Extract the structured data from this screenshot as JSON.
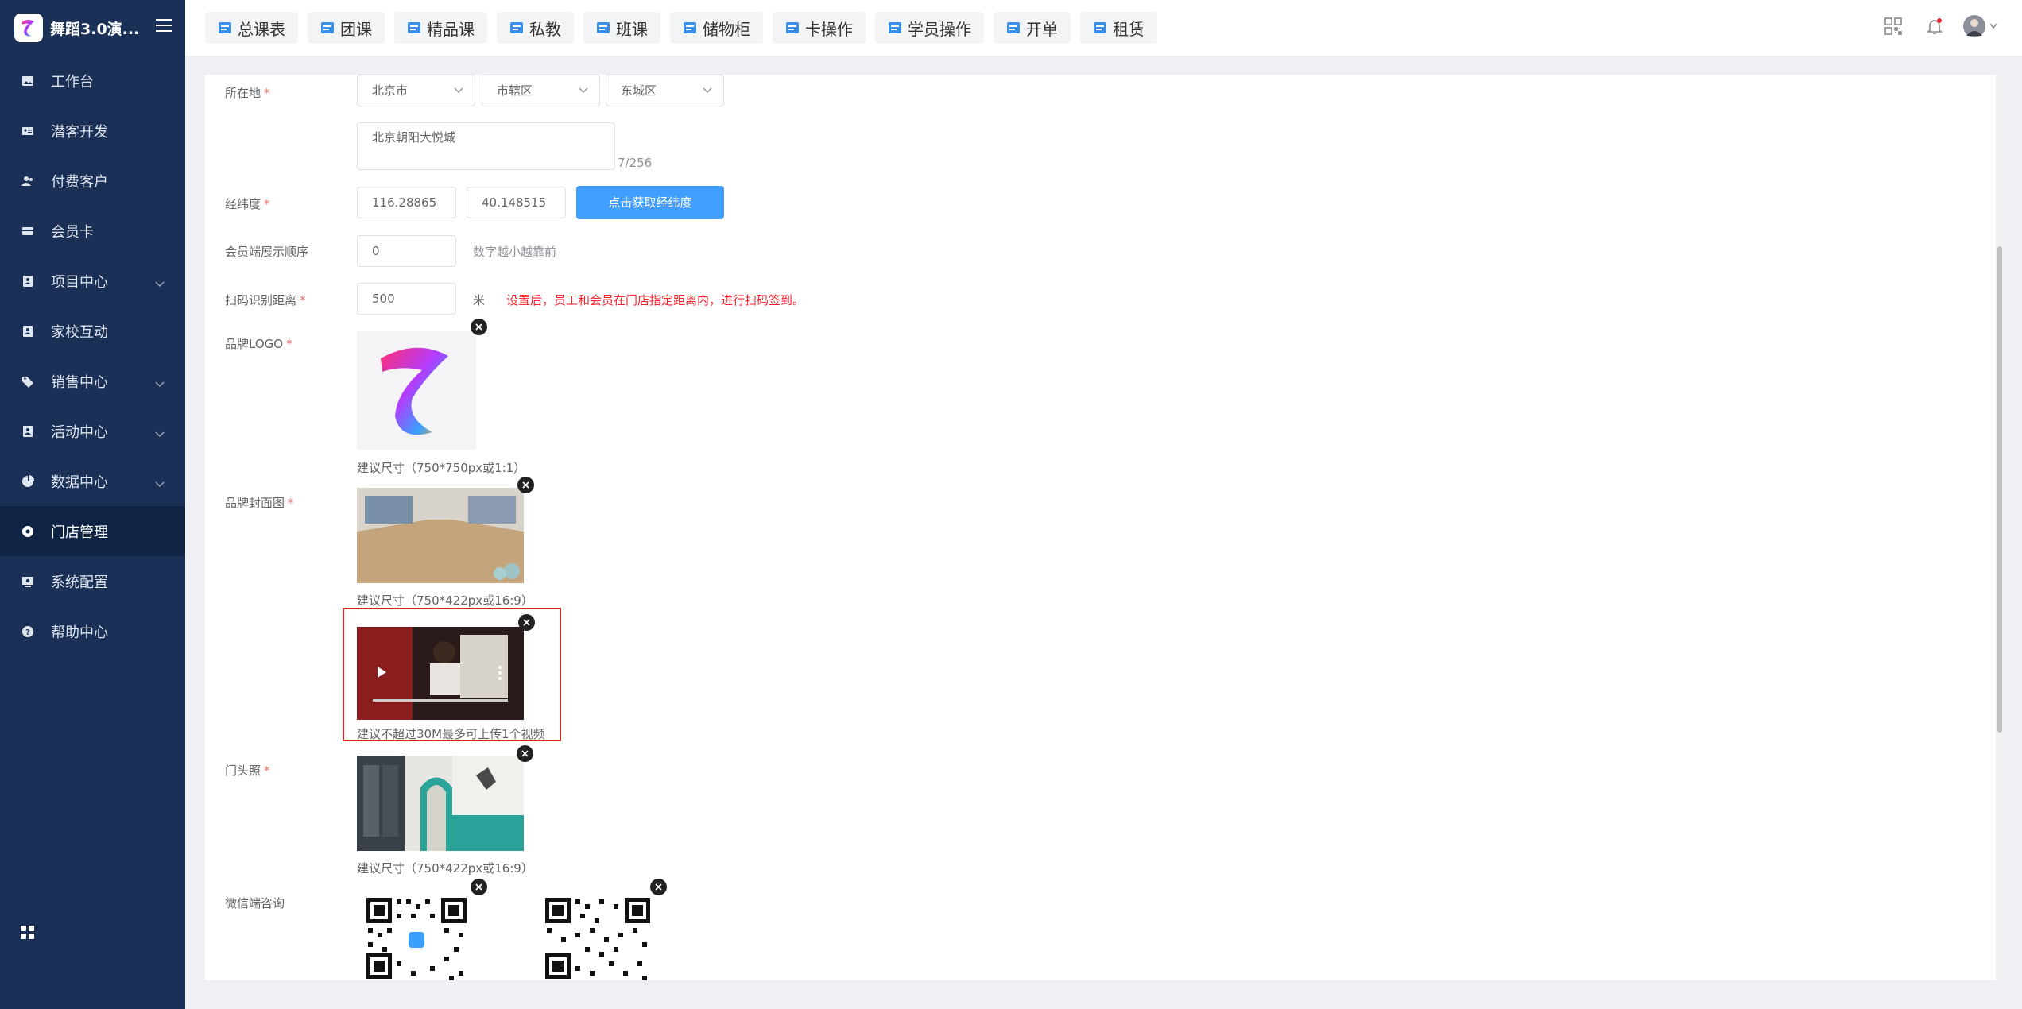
{
  "app": {
    "brand_name": "舞蹈3.0演..."
  },
  "sidebar": {
    "items": [
      {
        "label": "工作台",
        "icon": "image-icon"
      },
      {
        "label": "潜客开发",
        "icon": "id-card-icon"
      },
      {
        "label": "付费客户",
        "icon": "users-icon"
      },
      {
        "label": "会员卡",
        "icon": "card-icon"
      },
      {
        "label": "项目中心",
        "icon": "contact-icon"
      },
      {
        "label": "家校互动",
        "icon": "contact-icon"
      },
      {
        "label": "销售中心",
        "icon": "tag-icon"
      },
      {
        "label": "活动中心",
        "icon": "contact-icon"
      },
      {
        "label": "数据中心",
        "icon": "pie-chart-icon"
      },
      {
        "label": "门店管理",
        "icon": "circle-icon",
        "active": true
      },
      {
        "label": "系统配置",
        "icon": "settings-icon"
      },
      {
        "label": "帮助中心",
        "icon": "help-icon"
      }
    ]
  },
  "topbar": {
    "tabs": [
      "总课表",
      "团课",
      "精品课",
      "私教",
      "班课",
      "储物柜",
      "卡操作",
      "学员操作",
      "开单",
      "租赁"
    ]
  },
  "form": {
    "location": {
      "label": "所在地",
      "province": "北京市",
      "city": "市辖区",
      "district": "东城区",
      "address": "北京朝阳大悦城",
      "address_count": "7/256"
    },
    "coords": {
      "label": "经纬度",
      "lng": "116.28865",
      "lat": "40.148515",
      "button": "点击获取经纬度"
    },
    "order": {
      "label": "会员端展示顺序",
      "value": "0",
      "hint": "数字越小越靠前"
    },
    "scan": {
      "label": "扫码识别距离",
      "value": "500",
      "unit": "米",
      "warning": "设置后，员工和会员在门店指定距离内，进行扫码签到。"
    },
    "logo": {
      "label": "品牌LOGO",
      "caption": "建议尺寸（750*750px或1:1）"
    },
    "cover": {
      "label": "品牌封面图",
      "caption": "建议尺寸（750*422px或16:9）",
      "video_caption": "建议不超过30M最多可上传1个视频"
    },
    "storefront": {
      "label": "门头照",
      "caption": "建议尺寸（750*422px或16:9）"
    },
    "wechat": {
      "label": "微信端咨询"
    }
  },
  "colors": {
    "sidebar_bg": "#1a3057",
    "primary": "#409eff",
    "warning": "#f5222d",
    "highlight_border": "#e02020"
  }
}
